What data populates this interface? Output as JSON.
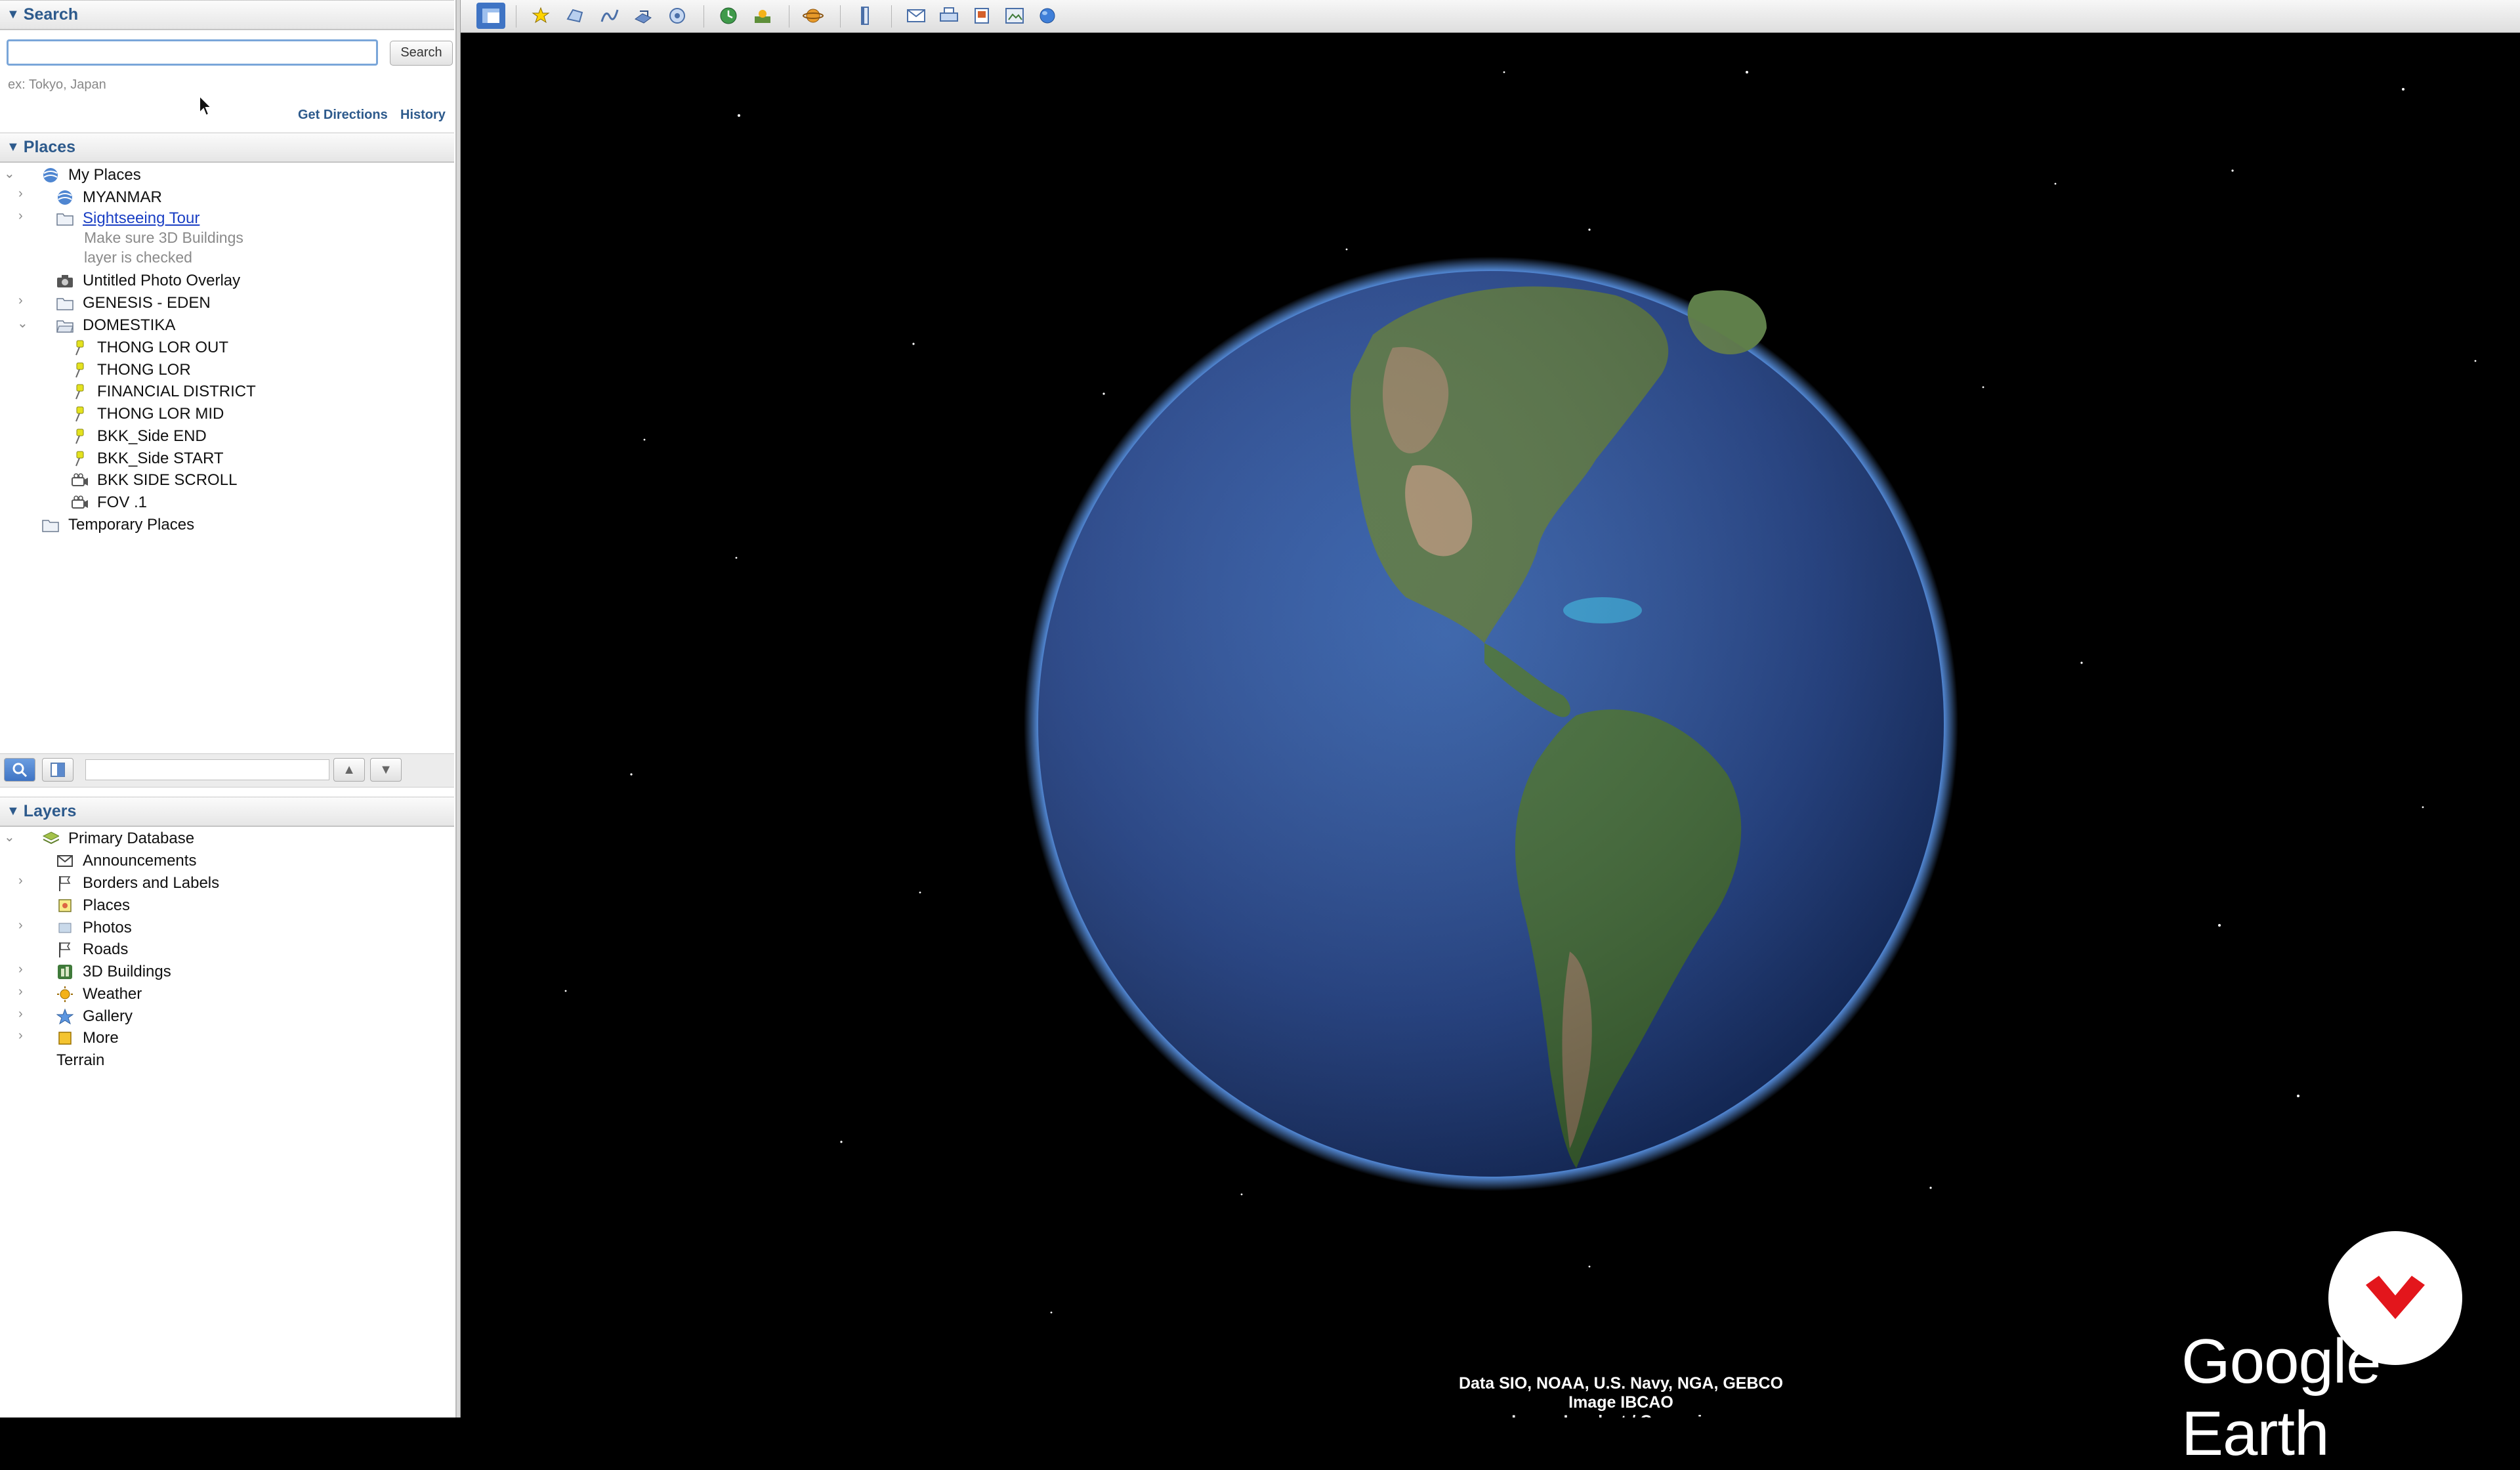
{
  "search": {
    "header": "Search",
    "input_value": "",
    "button_label": "Search",
    "hint": "ex: Tokyo, Japan",
    "get_directions": "Get Directions",
    "history": "History"
  },
  "places": {
    "header": "Places",
    "items": [
      {
        "label": "My Places"
      },
      {
        "label": "MYANMAR"
      },
      {
        "label": "Sightseeing Tour",
        "desc1": "Make sure 3D Buildings",
        "desc2": "layer is checked"
      },
      {
        "label": "Untitled Photo Overlay"
      },
      {
        "label": "GENESIS - EDEN"
      },
      {
        "label": "DOMESTIKA"
      },
      {
        "label": "THONG LOR OUT"
      },
      {
        "label": "THONG LOR"
      },
      {
        "label": "FINANCIAL DISTRICT"
      },
      {
        "label": "THONG LOR MID"
      },
      {
        "label": "BKK_Side END"
      },
      {
        "label": "BKK_Side START"
      },
      {
        "label": "BKK SIDE SCROLL"
      },
      {
        "label": "FOV .1"
      },
      {
        "label": "Temporary Places"
      }
    ]
  },
  "layers": {
    "header": "Layers",
    "items": [
      {
        "label": "Primary Database"
      },
      {
        "label": "Announcements"
      },
      {
        "label": "Borders and Labels"
      },
      {
        "label": "Places"
      },
      {
        "label": "Photos"
      },
      {
        "label": "Roads"
      },
      {
        "label": "3D Buildings"
      },
      {
        "label": "Weather"
      },
      {
        "label": "Gallery"
      },
      {
        "label": "More"
      },
      {
        "label": "Terrain"
      }
    ]
  },
  "view": {
    "attribution_line1": "Data SIO, NOAA, U.S. Navy, NGA, GEBCO",
    "attribution_line2": "Image IBCAO",
    "attribution_line3": "Image Landsat / Copernicus",
    "brand": "Google Earth"
  },
  "colors": {
    "header_text": "#2d5a8c",
    "link": "#1a3fc4",
    "pushpin": "#e4e21e",
    "badge_red": "#e3161c"
  }
}
